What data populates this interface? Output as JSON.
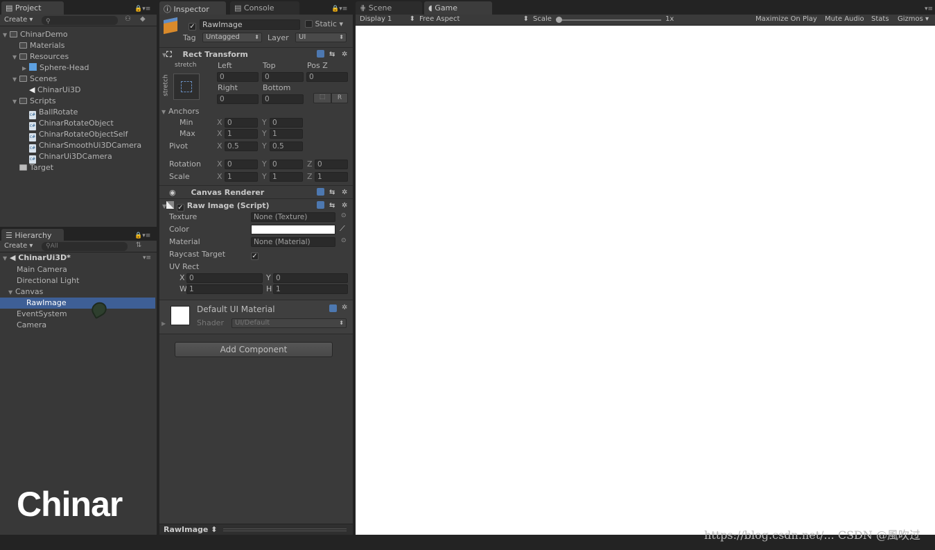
{
  "project": {
    "tab": "Project",
    "create": "Create",
    "items": [
      {
        "label": "ChinarDemo",
        "type": "folder",
        "depth": 0,
        "arrow": "▼"
      },
      {
        "label": "Materials",
        "type": "folder",
        "depth": 1,
        "arrow": ""
      },
      {
        "label": "Resources",
        "type": "folder",
        "depth": 1,
        "arrow": "▼"
      },
      {
        "label": "Sphere-Head",
        "type": "prefab",
        "depth": 2,
        "arrow": "▶"
      },
      {
        "label": "Scenes",
        "type": "folder",
        "depth": 1,
        "arrow": "▼"
      },
      {
        "label": "ChinarUi3D",
        "type": "scene",
        "depth": 2,
        "arrow": ""
      },
      {
        "label": "Scripts",
        "type": "folder",
        "depth": 1,
        "arrow": "▼"
      },
      {
        "label": "BallRotate",
        "type": "script",
        "depth": 2,
        "arrow": ""
      },
      {
        "label": "ChinarRotateObject",
        "type": "script",
        "depth": 2,
        "arrow": ""
      },
      {
        "label": "ChinarRotateObjectSelf",
        "type": "script",
        "depth": 2,
        "arrow": ""
      },
      {
        "label": "ChinarSmoothUi3DCamera",
        "type": "script",
        "depth": 2,
        "arrow": ""
      },
      {
        "label": "ChinarUi3DCamera",
        "type": "script",
        "depth": 2,
        "arrow": ""
      },
      {
        "label": "Target",
        "type": "other",
        "depth": 1,
        "arrow": ""
      }
    ]
  },
  "hierarchy": {
    "tab": "Hierarchy",
    "create": "Create",
    "search_placeholder": "All",
    "scene": "ChinarUi3D*",
    "items": [
      {
        "label": "Main Camera",
        "depth": 1,
        "arrow": "",
        "selected": false
      },
      {
        "label": "Directional Light",
        "depth": 1,
        "arrow": "",
        "selected": false
      },
      {
        "label": "Canvas",
        "depth": 1,
        "arrow": "▼",
        "selected": false
      },
      {
        "label": "RawImage",
        "depth": 2,
        "arrow": "",
        "selected": true
      },
      {
        "label": "EventSystem",
        "depth": 1,
        "arrow": "",
        "selected": false
      },
      {
        "label": "Camera",
        "depth": 1,
        "arrow": "",
        "selected": false
      }
    ]
  },
  "logo": "Chinar",
  "inspector": {
    "tab": "Inspector",
    "console_tab": "Console",
    "object_name": "RawImage",
    "static_label": "Static",
    "tag_label": "Tag",
    "tag_value": "Untagged",
    "layer_label": "Layer",
    "layer_value": "UI",
    "rect": {
      "title": "Rect Transform",
      "stretch_top": "stretch",
      "stretch_side": "stretch",
      "col1": "Left",
      "col2": "Top",
      "col3": "Pos Z",
      "v1": "0",
      "v2": "0",
      "v3": "0",
      "col4": "Right",
      "col5": "Bottom",
      "v4": "0",
      "v5": "0",
      "r_btn": "R",
      "anchors": "Anchors",
      "min": "Min",
      "max": "Max",
      "pivot": "Pivot",
      "min_x": "0",
      "min_y": "0",
      "max_x": "1",
      "max_y": "1",
      "pivot_x": "0.5",
      "pivot_y": "0.5",
      "rotation": "Rotation",
      "scale": "Scale",
      "rot_x": "0",
      "rot_y": "0",
      "rot_z": "0",
      "sc_x": "1",
      "sc_y": "1",
      "sc_z": "1",
      "x": "X",
      "y": "Y",
      "z": "Z"
    },
    "canvas_renderer": "Canvas Renderer",
    "raw": {
      "title": "Raw Image (Script)",
      "texture_label": "Texture",
      "texture_value": "None (Texture)",
      "color_label": "Color",
      "material_label": "Material",
      "material_value": "None (Material)",
      "raycast_label": "Raycast Target",
      "uvrect_label": "UV Rect",
      "uv_x": "0",
      "uv_y": "0",
      "uv_w": "1",
      "uv_h": "1",
      "x": "X",
      "y": "Y",
      "w": "W",
      "h": "H"
    },
    "material": {
      "name": "Default UI Material",
      "shader_label": "Shader",
      "shader_value": "UI/Default"
    },
    "add_component": "Add Component",
    "footer": "RawImage"
  },
  "game": {
    "scene_tab": "Scene",
    "game_tab": "Game",
    "display": "Display 1",
    "aspect": "Free Aspect",
    "scale_label": "Scale",
    "scale_value": "1x",
    "maximize": "Maximize On Play",
    "mute": "Mute Audio",
    "stats": "Stats",
    "gizmos": "Gizmos"
  },
  "watermark": "https://blog.csdn.net/... CSDN @風吹过",
  "colors": {
    "selection": "#3e5f96",
    "panel": "#383838",
    "game_bg": "#ffffff"
  }
}
